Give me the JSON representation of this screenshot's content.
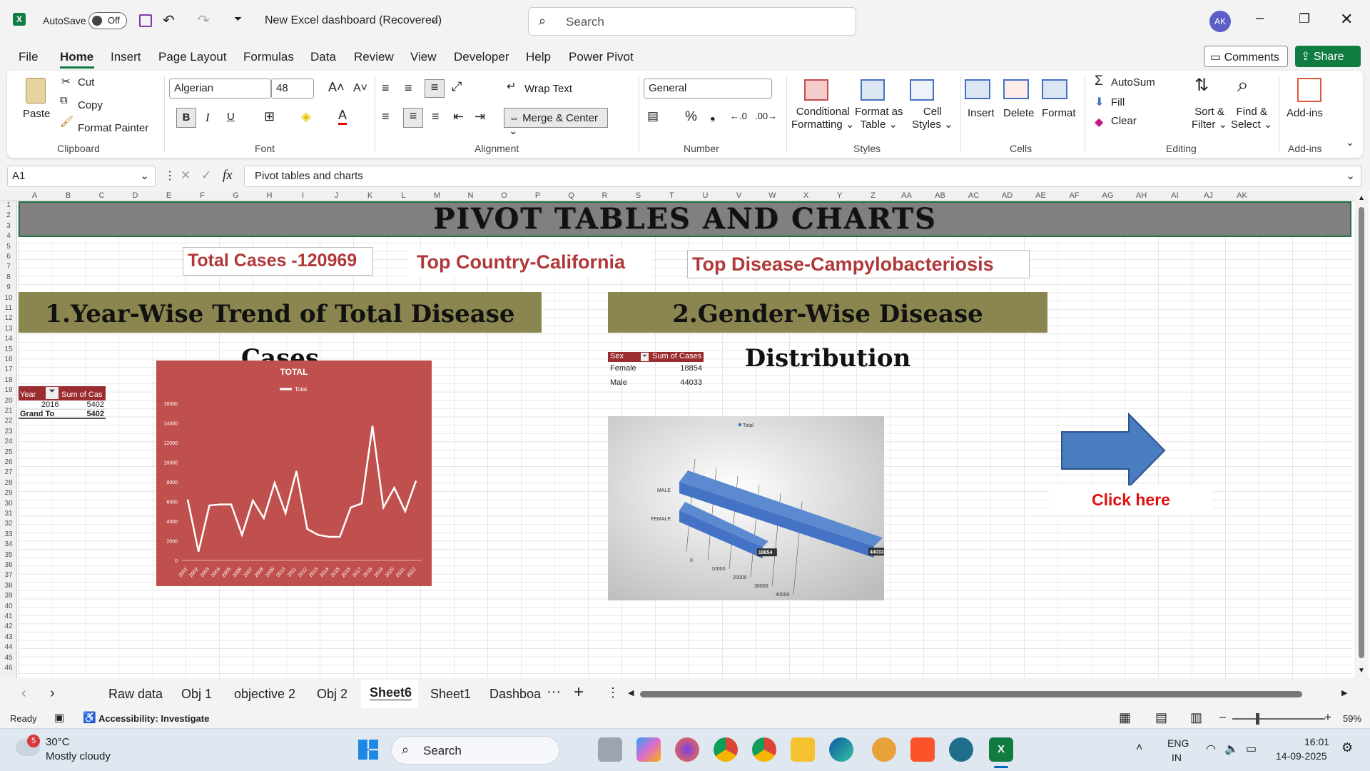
{
  "app": {
    "autosave_label": "AutoSave",
    "autosave_state": "Off",
    "doc_title": "New Excel dashboard (Recovered)",
    "search_placeholder": "Search",
    "avatar_initials": "AK"
  },
  "tabs": [
    "File",
    "Home",
    "Insert",
    "Page Layout",
    "Formulas",
    "Data",
    "Review",
    "View",
    "Developer",
    "Help",
    "Power Pivot"
  ],
  "buttons": {
    "comments": "Comments",
    "share": "Share"
  },
  "ribbon": {
    "clipboard": {
      "paste": "Paste",
      "cut": "Cut",
      "copy": "Copy",
      "format_painter": "Format Painter",
      "label": "Clipboard"
    },
    "font": {
      "family": "Algerian",
      "size": "48",
      "label": "Font"
    },
    "alignment": {
      "wrap": "Wrap Text",
      "merge": "Merge & Center",
      "label": "Alignment"
    },
    "number": {
      "format": "General",
      "label": "Number"
    },
    "styles": {
      "conditional": "Conditional",
      "conditional2": "Formatting",
      "format_table": "Format as",
      "format_table2": "Table",
      "cell_styles": "Cell",
      "cell_styles2": "Styles",
      "label": "Styles"
    },
    "cells": {
      "insert": "Insert",
      "delete": "Delete",
      "format": "Format",
      "label": "Cells"
    },
    "editing": {
      "autosum": "AutoSum",
      "fill": "Fill",
      "clear": "Clear",
      "sort": "Sort &",
      "sort2": "Filter",
      "find": "Find &",
      "find2": "Select",
      "label": "Editing"
    },
    "addins": {
      "addins": "Add-ins",
      "label": "Add-ins"
    }
  },
  "formula_bar": {
    "name_box": "A1",
    "fx": "fx",
    "content": "Pivot tables and charts"
  },
  "columns": [
    "A",
    "B",
    "C",
    "D",
    "E",
    "F",
    "G",
    "H",
    "I",
    "J",
    "K",
    "L",
    "M",
    "N",
    "O",
    "P",
    "Q",
    "R",
    "S",
    "T",
    "U",
    "V",
    "W",
    "X",
    "Y",
    "Z",
    "AA",
    "AB",
    "AC",
    "AD",
    "AE",
    "AF",
    "AG",
    "AH",
    "AI",
    "AJ",
    "AK"
  ],
  "sheet": {
    "banner": "PIVOT TABLES AND CHARTS",
    "kpi1": "Total Cases -120969",
    "kpi2": "Top Country-California",
    "kpi3": "Top Disease-Campylobacteriosis",
    "section1": "1.Year-Wise Trend of Total Disease Cases",
    "section2": "2.Gender-Wise Disease Distribution",
    "pivot1": {
      "h1": "Year",
      "h2": "Sum of Cas",
      "row_year": "2016",
      "row_val": "5402",
      "total_label": "Grand To",
      "total_val": "5402"
    },
    "pivot2": {
      "h1": "Sex",
      "h2": "Sum of Cases",
      "r1": "Female",
      "v1": "18854",
      "r2": "Male",
      "v2": "44033"
    },
    "click_here": "Click here"
  },
  "chart_data": [
    {
      "type": "line",
      "title": "TOTAL",
      "legend": "Total",
      "series": [
        {
          "name": "Total",
          "values": [
            6200,
            900,
            5600,
            5700,
            5700,
            2600,
            6100,
            4300,
            7900,
            4800,
            9100,
            3200,
            2600,
            2400,
            2400,
            5400,
            5800,
            13700,
            5400,
            7400,
            5000,
            8100
          ]
        }
      ],
      "x": [
        "2001",
        "2002",
        "2003",
        "2004",
        "2005",
        "2006",
        "2007",
        "2008",
        "2009",
        "2010",
        "2011",
        "2012",
        "2013",
        "2014",
        "2015",
        "2016",
        "2017",
        "2018",
        "2019",
        "2020",
        "2021",
        "2022"
      ],
      "yticks": [
        "0",
        "2000",
        "4000",
        "6000",
        "8000",
        "10000",
        "12000",
        "14000",
        "16000"
      ],
      "ylim": [
        0,
        16000
      ],
      "colors": {
        "bg": "#c0504d",
        "line": "#ffffff"
      }
    },
    {
      "type": "bar",
      "legend": "Total",
      "categories": [
        "FEMALE",
        "MALE"
      ],
      "values": [
        18854,
        44033
      ],
      "xticks": [
        "0",
        "10000",
        "20000",
        "30000",
        "40000",
        "50000"
      ],
      "xlim": [
        0,
        50000
      ],
      "colors": {
        "bar": "#4472c4"
      }
    }
  ],
  "sheet_tabs": [
    "Raw data",
    "Obj 1",
    "objective 2",
    "Obj 2",
    "Sheet6",
    "Sheet1",
    "Dashboa"
  ],
  "status": {
    "ready": "Ready",
    "accessibility": "Accessibility: Investigate",
    "zoom": "59%"
  },
  "taskbar": {
    "temp": "30°C",
    "weather": "Mostly cloudy",
    "badge": "5",
    "search": "Search",
    "lang1": "ENG",
    "lang2": "IN",
    "time": "16:01",
    "date": "14-09-2025"
  }
}
